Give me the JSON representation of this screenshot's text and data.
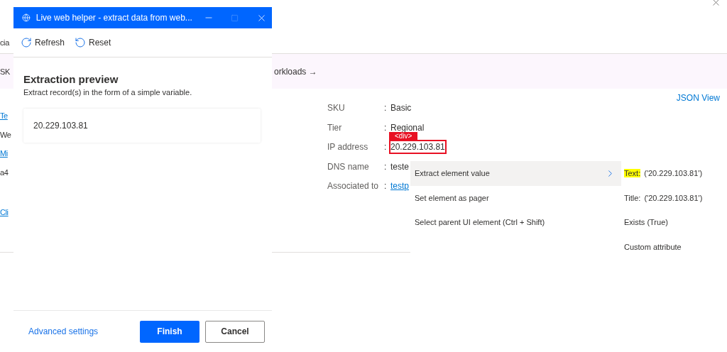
{
  "page": {
    "tab_fragment": "cia",
    "banner": {
      "fragment": "SK",
      "link": "orkloads",
      "arrow": "→"
    },
    "json_view": "JSON View",
    "left_fragments": [
      {
        "text": "Te",
        "kind": "link"
      },
      {
        "text": "We",
        "kind": "text"
      },
      {
        "text": "Mi",
        "kind": "link"
      },
      {
        "text": "a4",
        "kind": "text"
      }
    ],
    "left_footer_link": "Cli",
    "properties": [
      {
        "label": "SKU",
        "separator": ":",
        "value": "Basic",
        "kind": "text"
      },
      {
        "label": "Tier",
        "separator": ":",
        "value": "Regional",
        "kind": "text"
      },
      {
        "label": "IP address",
        "separator": ":",
        "value": "20.229.103.81",
        "kind": "highlighted",
        "tag": "<div>"
      },
      {
        "label": "DNS name",
        "separator": ":",
        "value": "teste",
        "kind": "text"
      },
      {
        "label": "Associated to",
        "separator": ":",
        "value": "testp",
        "kind": "link"
      }
    ]
  },
  "helper_window": {
    "title": "Live web helper - extract data from web...",
    "toolbar": [
      {
        "label": "Refresh",
        "kind": "refresh"
      },
      {
        "label": "Reset",
        "kind": "reset"
      }
    ],
    "heading": "Extraction preview",
    "subtitle": "Extract record(s) in the form of a simple variable.",
    "preview_value": "20.229.103.81",
    "footer_link": "Advanced settings",
    "buttons": [
      {
        "label": "Finish",
        "kind": "primary"
      },
      {
        "label": "Cancel",
        "kind": "secondary"
      }
    ]
  },
  "context_menu": {
    "items": [
      {
        "label": "Extract element value",
        "has_submenu": true,
        "selected": true
      },
      {
        "label": "Set element as pager",
        "has_submenu": false,
        "selected": false
      },
      {
        "label": "Select parent UI element  (Ctrl + Shift)",
        "has_submenu": false,
        "selected": false
      }
    ],
    "submenu": [
      {
        "key": "Text:",
        "value": "('20.229.103.81')",
        "highlighted": true
      },
      {
        "key": "Title:",
        "value": "('20.229.103.81')",
        "highlighted": false
      },
      {
        "key": "Exists (True)",
        "highlighted": false
      },
      {
        "key": "Custom attribute",
        "highlighted": false
      }
    ]
  }
}
